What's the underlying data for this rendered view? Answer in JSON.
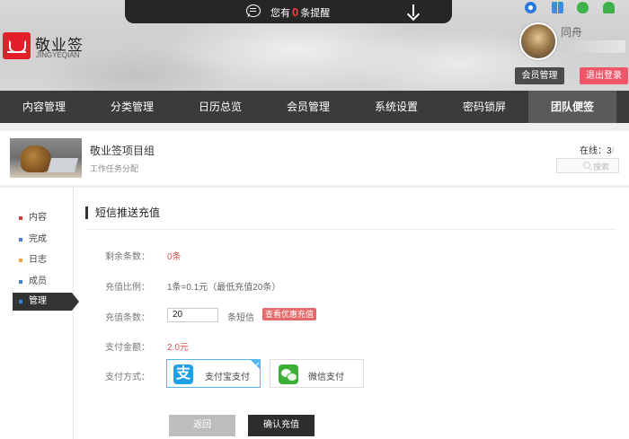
{
  "notify": {
    "prefix": "您有",
    "count": "0",
    "suffix": "条提醒"
  },
  "brand": {
    "name": "敬业签",
    "sub": "JINGYEQIAN"
  },
  "browser_icons": [
    "ie-icon",
    "windows-icon",
    "apple-icon",
    "android-icon"
  ],
  "user": {
    "name": "同舟",
    "member_btn": "会员管理",
    "logout_btn": "退出登录"
  },
  "nav": [
    {
      "label": "内容管理"
    },
    {
      "label": "分类管理"
    },
    {
      "label": "日历总览"
    },
    {
      "label": "会员管理"
    },
    {
      "label": "系统设置"
    },
    {
      "label": "密码锁屏"
    },
    {
      "label": "团队便签",
      "active": true
    }
  ],
  "group": {
    "title": "敬业签项目组",
    "subtitle": "工作任务分配",
    "online_label": "在线：3",
    "online_slash": "/",
    "search_placeholder": "搜索"
  },
  "side_menu": [
    {
      "label": "内容",
      "color": "#e0373f"
    },
    {
      "label": "完成",
      "color": "#3b7fd8"
    },
    {
      "label": "日志",
      "color": "#f2a63a"
    },
    {
      "label": "成员",
      "color": "#3b7fd8"
    },
    {
      "label": "管理",
      "color": "#3b7fd8",
      "active": true
    }
  ],
  "section": {
    "title": "短信推送充值"
  },
  "form": {
    "remaining_label": "剩余条数：",
    "remaining_value": "0条",
    "ratio_label": "充值比例：",
    "ratio_value": "1条=0.1元（最低充值20条）",
    "qty_label": "充值条数：",
    "qty_value": "20",
    "qty_unit": "条短信",
    "promo_btn": "查看优惠充值",
    "amount_label": "支付金额：",
    "amount_value": "2.0元",
    "method_label": "支付方式："
  },
  "payment": {
    "alipay_label": "支付宝支付",
    "alipay_glyph": "支",
    "wechat_label": "微信支付",
    "selected": "alipay"
  },
  "actions": {
    "back": "返回",
    "confirm": "确认充值"
  },
  "colors": {
    "accent_red": "#e3202a",
    "logout": "#f0566a",
    "nav_bg": "#3b3b3b",
    "selected_border": "#55b8e8"
  }
}
